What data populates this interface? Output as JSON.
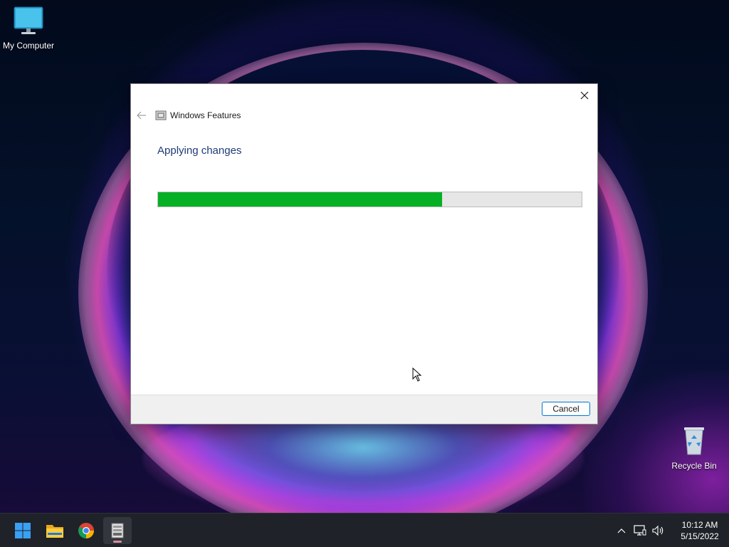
{
  "desktop": {
    "icons": [
      {
        "label": "My Computer"
      },
      {
        "label": "Recycle Bin"
      }
    ]
  },
  "dialog": {
    "title": "Windows Features",
    "heading": "Applying changes",
    "progress_fraction": 0.67,
    "cancel_label": "Cancel"
  },
  "taskbar": {
    "apps": [
      {
        "icon": "windows-start-icon"
      },
      {
        "icon": "file-explorer-icon"
      },
      {
        "icon": "chrome-icon"
      },
      {
        "icon": "windows-features-icon",
        "active": true
      }
    ],
    "tray": {
      "icons": [
        "chevron-up-icon",
        "network-icon",
        "volume-icon"
      ],
      "time": "10:12 AM",
      "date": "5/15/2022"
    }
  },
  "colors": {
    "progress_fill": "#06b025",
    "heading": "#1e3a78",
    "accent": "#0078d7"
  }
}
